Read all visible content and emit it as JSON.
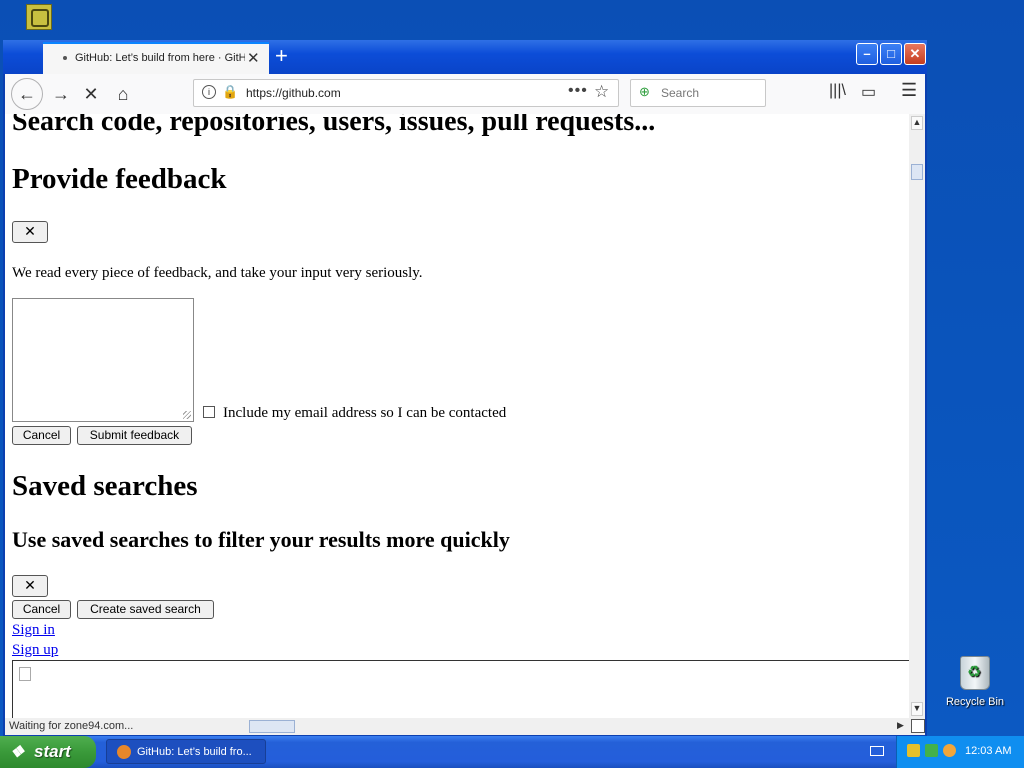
{
  "desktop": {
    "recycle_bin_label": "Recycle Bin"
  },
  "browser": {
    "tab_title": "GitHub: Let’s build from here · GitHub",
    "url": "https://github.com",
    "search_placeholder": "Search",
    "status_text": "Waiting for zone94.com..."
  },
  "page": {
    "top_heading": "Search code, repositories, users, issues, pull requests...",
    "feedback_heading": "Provide feedback",
    "close_label": "✕",
    "feedback_text": "We read every piece of feedback, and take your input very seriously.",
    "include_email_label": "Include my email address so I can be contacted",
    "cancel_label": "Cancel",
    "submit_feedback_label": "Submit feedback",
    "saved_searches_heading": "Saved searches",
    "saved_searches_subheading": "Use saved searches to filter your results more quickly",
    "create_saved_search_label": "Create saved search",
    "sign_in_label": "Sign in",
    "sign_up_label": "Sign up"
  },
  "taskbar": {
    "start_label": "start",
    "task_title": "GitHub: Let’s build fro...",
    "clock": "12:03 AM"
  }
}
